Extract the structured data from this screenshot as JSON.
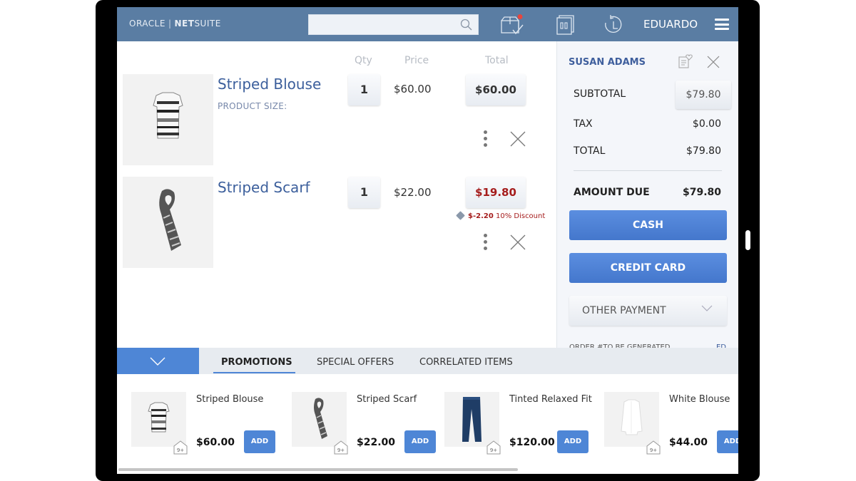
{
  "header": {
    "logo_oracle": "ORACLE",
    "logo_sep": "|",
    "logo_net": "NET",
    "logo_suite": "SUITE",
    "search_placeholder": "",
    "icons": [
      "package-check-icon",
      "register-icon",
      "history-icon"
    ],
    "user": "EDUARDO",
    "notification_color": "#e8463d"
  },
  "cart": {
    "columns": {
      "qty": "Qty",
      "price": "Price",
      "total": "Total"
    },
    "items": [
      {
        "name": "Striped Blouse",
        "size_label": "PRODUCT SIZE:",
        "qty": "1",
        "price": "$60.00",
        "total": "$60.00",
        "discount": null
      },
      {
        "name": "Striped Scarf",
        "size_label": "",
        "qty": "1",
        "price": "$22.00",
        "total": "$19.80",
        "discount": {
          "amount": "$-2.20",
          "label": "10% Discount"
        }
      }
    ]
  },
  "summary": {
    "customer": "SUSAN ADAMS",
    "subtotal_label": "SUBTOTAL",
    "subtotal": "$79.80",
    "tax_label": "TAX",
    "tax": "$0.00",
    "total_label": "TOTAL",
    "total": "$79.80",
    "amount_due_label": "AMOUNT DUE",
    "amount_due": "$79.80",
    "cash_label": "CASH",
    "credit_label": "CREDIT CARD",
    "other_label": "OTHER PAYMENT",
    "order_label": "ORDER #TO BE GENERATED",
    "order_right": "ED"
  },
  "tabs": {
    "items": [
      "PROMOTIONS",
      "SPECIAL OFFERS",
      "CORRELATED ITEMS"
    ],
    "active": "PROMOTIONS"
  },
  "suggestions": [
    {
      "name": "Striped Blouse",
      "price": "$60.00",
      "add": "ADD",
      "stock": "9+"
    },
    {
      "name": "Striped Scarf",
      "price": "$22.00",
      "add": "ADD",
      "stock": "9+"
    },
    {
      "name": "Tinted Relaxed Fit",
      "price": "$120.00",
      "add": "ADD",
      "stock": "9+"
    },
    {
      "name": "White Blouse",
      "price": "$44.00",
      "add": "ADD",
      "stock": "9+"
    }
  ],
  "colors": {
    "header_bg": "#5a7da3",
    "accent": "#4e86d6",
    "discount": "#a51c1c",
    "customer": "#3f5f9d"
  }
}
